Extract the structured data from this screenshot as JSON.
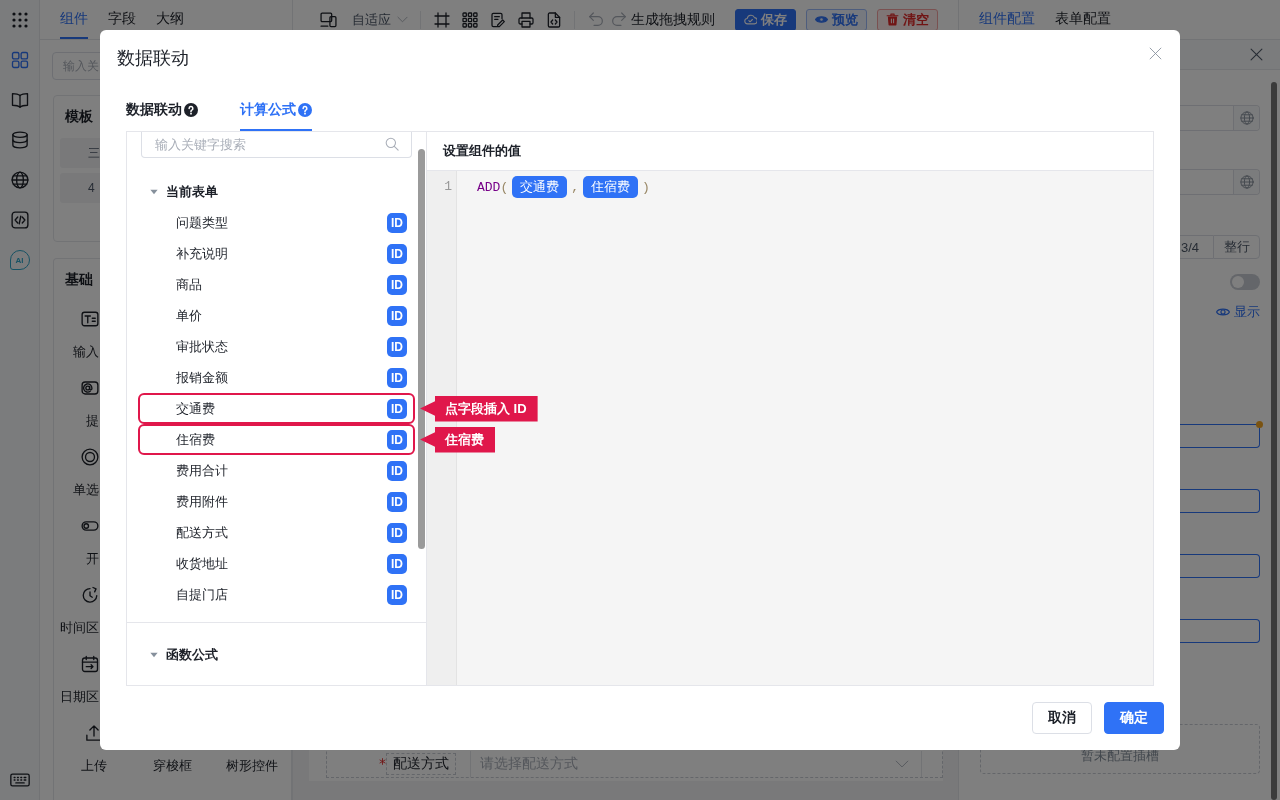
{
  "rail": {
    "items": [
      {
        "selected": true
      },
      {
        "selected": false
      },
      {
        "selected": false
      },
      {
        "selected": false
      },
      {
        "selected": false
      },
      {
        "label": "AI",
        "selected": false
      }
    ]
  },
  "left_panel": {
    "tabs": [
      {
        "label": "组件",
        "selected": true
      },
      {
        "label": "字段",
        "selected": false
      },
      {
        "label": "大纲",
        "selected": false
      }
    ],
    "search": {
      "placeholder": "输入关"
    },
    "template_section": {
      "title": "模板",
      "items": [
        {
          "label": "三"
        },
        {
          "label": "4"
        }
      ]
    },
    "basic_section": {
      "title": "基础",
      "component_rows": [
        [
          {
            "label": "输入",
            "kind": "input"
          }
        ],
        [
          {
            "label": "提",
            "kind": "mention"
          }
        ],
        [
          {
            "label": "单选",
            "kind": "radio"
          }
        ],
        [
          {
            "label": "开",
            "kind": "switch"
          }
        ],
        [
          {
            "label": "时间区",
            "kind": "time"
          }
        ],
        [
          {
            "label": "日期区",
            "kind": "date"
          }
        ],
        [
          {
            "label": "上传",
            "kind": "upload"
          },
          {
            "label": "穿梭框",
            "kind": "transfer"
          },
          {
            "label": "树形控件",
            "kind": "tree"
          }
        ]
      ]
    }
  },
  "center": {
    "toolbar": {
      "layout": "自适应",
      "rule_label": "生成拖拽规则",
      "buttons": [
        {
          "label": "保存",
          "kind": "primary"
        },
        {
          "label": "预览",
          "kind": "info"
        },
        {
          "label": "清空",
          "kind": "danger"
        }
      ]
    },
    "canvas": {
      "form_items": [
        {
          "label": "配送方式",
          "required": true,
          "placeholder": "请选择配送方式"
        }
      ]
    }
  },
  "right_panel": {
    "tabs": [
      {
        "label": "组件配置",
        "selected": true
      },
      {
        "label": "表单配置",
        "selected": false
      }
    ],
    "width_options": [
      {
        "label": "3/4",
        "selected": false
      },
      {
        "label": "整行",
        "selected": false
      }
    ],
    "toggle": {
      "on": false
    },
    "visibility": "显示",
    "linked_fields": [
      {
        "changed": true
      },
      {
        "changed": false
      },
      {
        "changed": false
      },
      {
        "changed": false
      }
    ],
    "slot_placeholder": "暂未配置插槽"
  },
  "dialog": {
    "title": "数据联动",
    "tabs": [
      {
        "label": "数据联动",
        "selected": false
      },
      {
        "label": "计算公式",
        "selected": true
      }
    ],
    "field_panel": {
      "search": {
        "placeholder": "输入关键字搜索"
      },
      "groups": [
        {
          "label": "当前表单",
          "expanded": true,
          "children": [
            {
              "label": "问题类型",
              "badge": "ID",
              "highlighted": false
            },
            {
              "label": "补充说明",
              "badge": "ID",
              "highlighted": false
            },
            {
              "label": "商品",
              "badge": "ID",
              "highlighted": false
            },
            {
              "label": "单价",
              "badge": "ID",
              "highlighted": false
            },
            {
              "label": "审批状态",
              "badge": "ID",
              "highlighted": false
            },
            {
              "label": "报销金额",
              "badge": "ID",
              "highlighted": false
            },
            {
              "label": "交通费",
              "badge": "ID",
              "highlighted": true,
              "callout": "点字段插入 ID"
            },
            {
              "label": "住宿费",
              "badge": "ID",
              "highlighted": true,
              "callout": "住宿费"
            },
            {
              "label": "费用合计",
              "badge": "ID",
              "highlighted": false
            },
            {
              "label": "费用附件",
              "badge": "ID",
              "highlighted": false
            },
            {
              "label": "配送方式",
              "badge": "ID",
              "highlighted": false
            },
            {
              "label": "收货地址",
              "badge": "ID",
              "highlighted": false
            },
            {
              "label": "自提门店",
              "badge": "ID",
              "highlighted": false
            }
          ]
        },
        {
          "label": "函数公式",
          "expanded": true
        }
      ]
    },
    "editor": {
      "title": "设置组件的值",
      "lines": [
        {
          "number": "1",
          "tokens": [
            {
              "kind": "function",
              "text": "ADD"
            },
            {
              "kind": "punct",
              "text": "("
            },
            {
              "kind": "field",
              "text": "交通费"
            },
            {
              "kind": "punct",
              "text": ","
            },
            {
              "kind": "field",
              "text": "住宿费"
            },
            {
              "kind": "punct",
              "text": ")"
            }
          ]
        }
      ]
    },
    "buttons": [
      {
        "label": "取消",
        "kind": "default"
      },
      {
        "label": "确定",
        "kind": "primary"
      }
    ]
  }
}
